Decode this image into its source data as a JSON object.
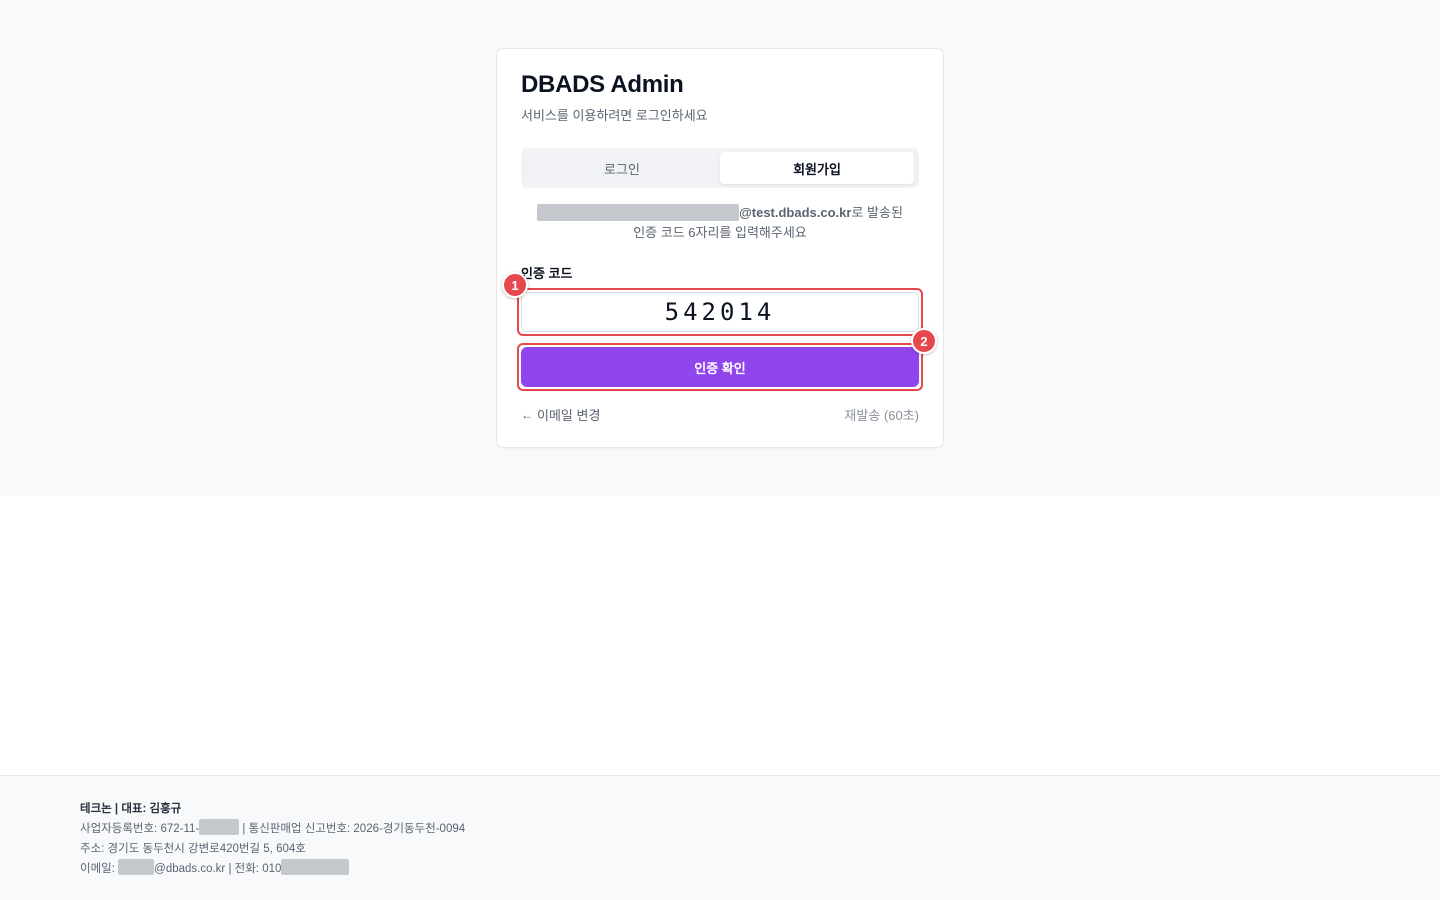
{
  "card": {
    "title": "DBADS Admin",
    "subtitle": "서비스를 이용하려면 로그인하세요"
  },
  "tabs": {
    "login": "로그인",
    "signup": "회원가입",
    "active": "signup"
  },
  "notice": {
    "email_domain": "@test.dbads.co.kr",
    "line1_suffix": "로 발송된",
    "line2": "인증 코드 6자리를 입력해주세요"
  },
  "form": {
    "code_label": "인증 코드",
    "code_value": "542014",
    "verify_button": "인증 확인",
    "back_link": "이메일 변경",
    "resend": "재발송 (60초)"
  },
  "annotations": {
    "badge1": "1",
    "badge2": "2"
  },
  "footer": {
    "company": "테크논 | 대표: 김홍규",
    "biz_reg_prefix": "사업자등록번호: 672-11-",
    "biz_reg_suffix": " | 통신판매업 신고번호: 2026-경기동두천-0094",
    "address": "주소: 경기도 동두천시 강변로420번길 5, 604호",
    "email_prefix": "이메일: ",
    "email_domain": "@dbads.co.kr",
    "phone_prefix": " | 전화: 010"
  },
  "colors": {
    "primary": "#9145ec",
    "highlight": "#e5484d",
    "page_bg": "#f8f9fb"
  }
}
